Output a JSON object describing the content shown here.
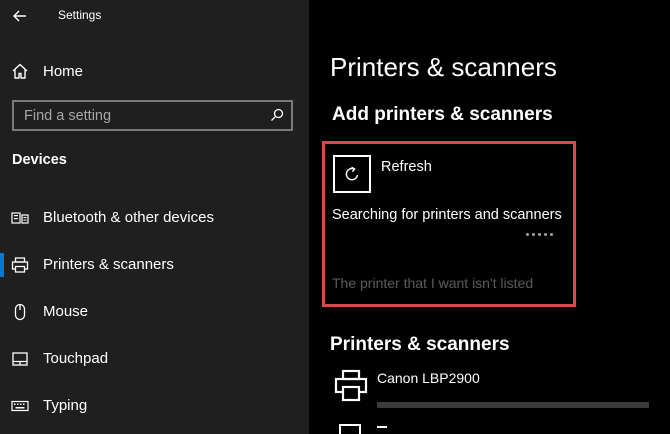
{
  "app": {
    "title": "Settings"
  },
  "sidebar": {
    "home_label": "Home",
    "search_placeholder": "Find a setting",
    "section_label": "Devices",
    "items": [
      {
        "label": "Bluetooth & other devices",
        "icon": "bluetooth-keyboard-icon",
        "selected": false
      },
      {
        "label": "Printers & scanners",
        "icon": "printer-icon",
        "selected": true
      },
      {
        "label": "Mouse",
        "icon": "mouse-icon",
        "selected": false
      },
      {
        "label": "Touchpad",
        "icon": "touchpad-icon",
        "selected": false
      },
      {
        "label": "Typing",
        "icon": "keyboard-icon",
        "selected": false
      }
    ]
  },
  "main": {
    "page_title": "Printers & scanners",
    "add_section_title": "Add printers & scanners",
    "refresh_label": "Refresh",
    "searching_text": "Searching for printers and scanners",
    "not_listed_link": "The printer that I want isn't listed",
    "list_section_title": "Printers & scanners",
    "devices": [
      {
        "name": "Canon LBP2900",
        "icon": "printer-icon"
      }
    ]
  },
  "colors": {
    "sidebar_bg": "#1f1f1f",
    "main_bg": "#000000",
    "accent": "#0078d7",
    "highlight_border": "#d94a4a",
    "disabled_text": "#5b5b5b"
  }
}
